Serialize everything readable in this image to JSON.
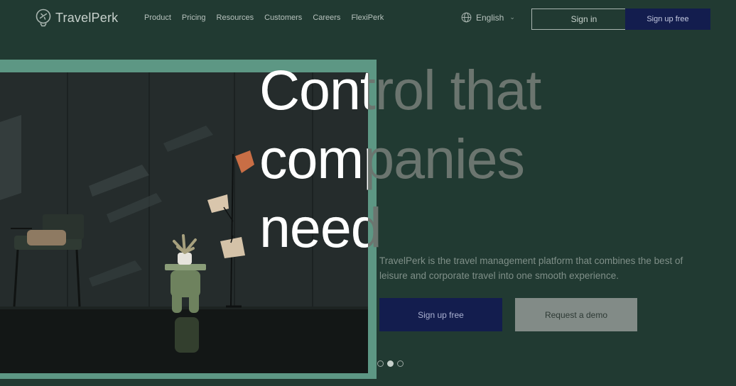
{
  "nav": {
    "logo_text": "TravelPerk",
    "links": [
      "Product",
      "Pricing",
      "Resources",
      "Customers",
      "Careers",
      "FlexiPerk"
    ],
    "language": "English",
    "sign_in_label": "Sign in",
    "sign_up_label": "Sign up free"
  },
  "hero": {
    "headline_lines": [
      "Control that",
      "companies",
      "need"
    ],
    "description": "TravelPerk is the travel management platform that combines the best of leisure and corporate travel into one smooth experience.",
    "primary_button": "Sign up free",
    "secondary_button": "Request a demo",
    "carousel": {
      "count": 3,
      "active_index": 1
    }
  },
  "colors": {
    "background": "#213a32",
    "frame_accent": "#5d9784",
    "navy_button": "#131d4e",
    "grey_button": "#828b87"
  },
  "icons": [
    "airplane-bubble-logo-icon",
    "globe-icon",
    "chevron-down-icon"
  ]
}
